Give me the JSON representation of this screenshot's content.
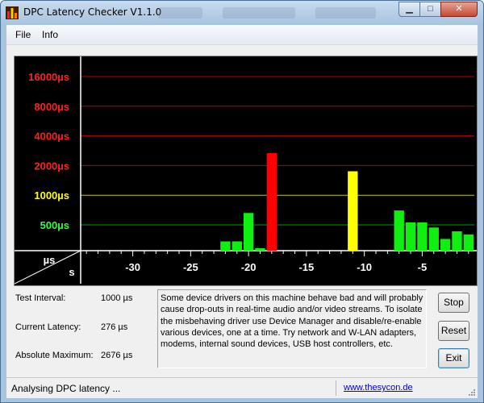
{
  "window": {
    "title": "DPC Latency Checker V1.1.0",
    "controls": {
      "minimize": "▁",
      "maximize": "□",
      "close": "✕"
    }
  },
  "menu": {
    "items": [
      "File",
      "Info"
    ]
  },
  "chart_data": {
    "type": "bar",
    "y_tick_labels": [
      {
        "label": "16000µs",
        "color": "#ff2020"
      },
      {
        "label": "8000µs",
        "color": "#ff2020"
      },
      {
        "label": "4000µs",
        "color": "#ff2020"
      },
      {
        "label": "2000µs",
        "color": "#ff2020"
      },
      {
        "label": "1000µs",
        "color": "#ffff00"
      },
      {
        "label": "500µs",
        "color": "#33ff33"
      }
    ],
    "y_levels_us": [
      16000,
      8000,
      4000,
      2000,
      1000,
      500
    ],
    "y_scale": "log2",
    "ylim": [
      125,
      32000
    ],
    "corner_labels": {
      "y_unit": "µs",
      "x_unit": "s"
    },
    "x_tick_labels": [
      "-30",
      "-25",
      "-20",
      "-15",
      "-10",
      "-5"
    ],
    "x_ticks": [
      -30,
      -25,
      -20,
      -15,
      -10,
      -5
    ],
    "xlim": [
      -34,
      0
    ],
    "values_us": [
      150,
      340,
      340,
      660,
      290,
      2676,
      190,
      240,
      200,
      210,
      270,
      220,
      1750,
      230,
      230,
      230,
      700,
      530,
      530,
      470,
      360,
      430,
      400
    ],
    "x_start": -23,
    "thresholds": {
      "green_max": 1000,
      "yellow_max": 2000
    },
    "colors": {
      "green": "#11ee11",
      "yellow": "#ffff00",
      "red": "#ff0000",
      "grid_red": "#c00000",
      "grid_yellow": "#c8c800",
      "grid_green": "#00a000"
    }
  },
  "info": {
    "test_interval_label": "Test Interval:",
    "test_interval_value": "1000 µs",
    "current_latency_label": "Current Latency:",
    "current_latency_value": "276 µs",
    "absolute_maximum_label": "Absolute Maximum:",
    "absolute_maximum_value": "2676 µs"
  },
  "description": "Some device drivers on this machine behave bad and will probably cause drop-outs in real-time audio and/or video streams. To isolate the misbehaving driver use Device Manager and disable/re-enable various devices, one at a time. Try network and W-LAN adapters, modems, internal sound devices, USB host controllers, etc.",
  "buttons": {
    "stop": "Stop",
    "reset": "Reset",
    "exit": "Exit"
  },
  "status": {
    "text": "Analysing DPC latency ...",
    "link": "www.thesycon.de"
  }
}
